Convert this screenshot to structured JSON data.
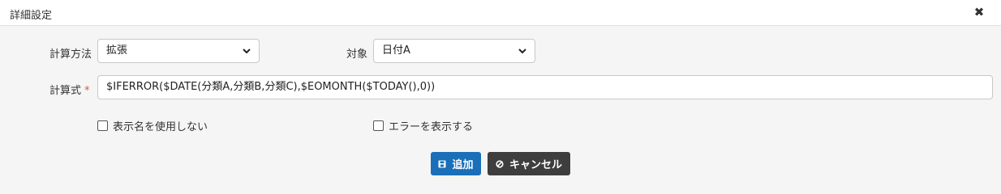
{
  "dialog": {
    "title": "詳細設定",
    "close_icon": "close-icon"
  },
  "form": {
    "calc_method": {
      "label": "計算方法",
      "value": "拡張"
    },
    "target": {
      "label": "対象",
      "value": "日付A"
    },
    "formula": {
      "label": "計算式",
      "required_mark": "*",
      "value": "$IFERROR($DATE(分類A,分類B,分類C),$EOMONTH($TODAY(),0))"
    },
    "hide_display_name": {
      "label": "表示名を使用しない",
      "checked": false
    },
    "show_error": {
      "label": "エラーを表示する",
      "checked": false
    }
  },
  "buttons": {
    "add": {
      "label": "追加",
      "icon": "save-icon"
    },
    "cancel": {
      "label": "キャンセル",
      "icon": "ban-icon"
    }
  },
  "colors": {
    "primary": "#1a6fb8",
    "cancel": "#3e3e3e",
    "required": "#d9534f"
  }
}
